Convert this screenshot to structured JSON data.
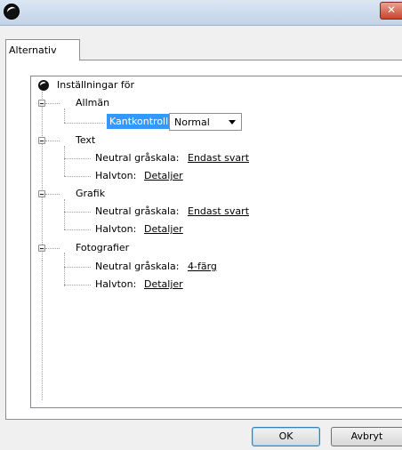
{
  "window": {
    "title": ""
  },
  "tabs": [
    {
      "label": "Alternativ"
    }
  ],
  "tree": {
    "root_label": "Inställningar för",
    "general": {
      "label": "Allmän",
      "edge_control_label": "Kantkontroll:",
      "edge_control_value": "Normal"
    },
    "text": {
      "label": "Text",
      "gray_label": "Neutral gråskala:",
      "gray_value": "Endast svart",
      "halftone_label": "Halvton:",
      "halftone_value": "Detaljer"
    },
    "graphics": {
      "label": "Grafik",
      "gray_label": "Neutral gråskala:",
      "gray_value": "Endast svart",
      "halftone_label": "Halvton:",
      "halftone_value": "Detaljer"
    },
    "photos": {
      "label": "Fotografier",
      "gray_label": "Neutral gråskala:",
      "gray_value": "4-färg",
      "halftone_label": "Halvton:",
      "halftone_value": "Detaljer"
    }
  },
  "buttons": {
    "ok": "OK",
    "cancel": "Avbryt"
  }
}
